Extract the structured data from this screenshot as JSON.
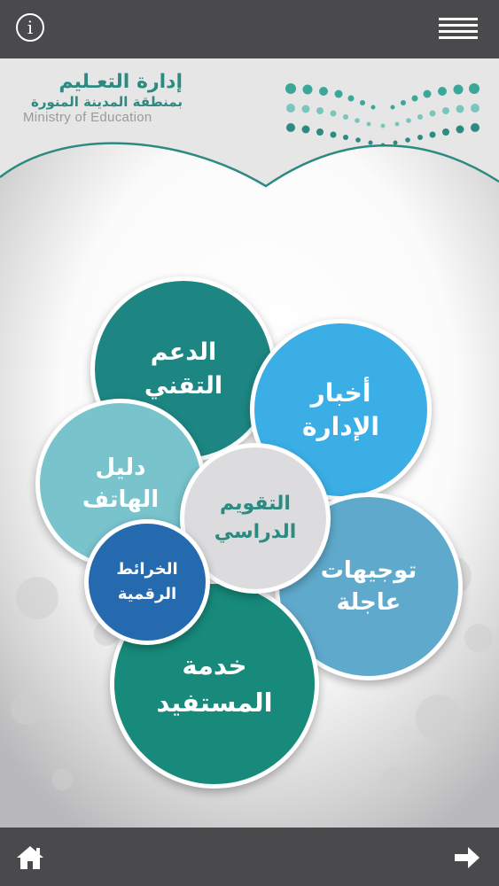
{
  "topbar": {
    "info_glyph": "i",
    "info_icon": "info-icon",
    "menu_icon": "hamburger-menu-icon"
  },
  "header": {
    "logo_arabic_line1": "إدارة التعـليم",
    "logo_arabic_line2": "بمنطقة المدينة المنورة",
    "logo_english": "Ministry of Education",
    "accent_color": "#2c8a80"
  },
  "menu": {
    "technical_support": "الدعم\nالتقني",
    "administration_news": "أخبار\nالإدارة",
    "phone_directory": "دليل\nالهاتف",
    "academic_calendar": "التقويم\nالدراسي",
    "urgent_directives": "توجيهات\nعاجلة",
    "digital_maps": "الخرائط\nالرقمية",
    "beneficiary_service": "خدمة\nالمستفيد"
  },
  "bottombar": {
    "home_icon": "home-icon",
    "next_icon": "arrow-right-icon"
  }
}
